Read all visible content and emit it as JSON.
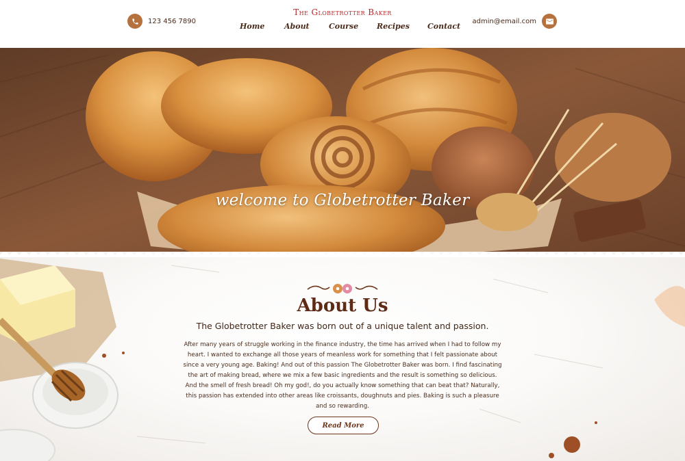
{
  "header": {
    "phone": "123 456 7890",
    "email": "admin@email.com",
    "brand": "The Globetrotter Baker",
    "nav": [
      "Home",
      "About",
      "Course",
      "Recipes",
      "Contact"
    ]
  },
  "icons": {
    "phone": "phone-icon",
    "email": "envelope-icon",
    "ornament": "donut-ornament-icon"
  },
  "hero": {
    "title": "welcome to Globetrotter Baker"
  },
  "about": {
    "title": "About Us",
    "subtitle": "The Globetrotter Baker was born out of a unique talent and passion.",
    "body": "After many years of struggle working in the finance industry, the time has arrived when I had to follow my heart. I wanted to exchange all those years of meanless work for something that I felt passionate about since a very young age. Baking! And out of this passion The Globetrotter Baker was born. I find fascinating the art of making bread, where we mix a few basic ingredients and the result is something so delicious. And the smell of fresh bread! Oh my god!, do you actually know something that can beat that? Naturally, this passion has extended into other areas like croissants, doughnuts and pies. Baking is such a pleasure and so rewarding.",
    "button": "Read More"
  },
  "colors": {
    "accent": "#b5723e",
    "brand": "#b3262a",
    "text_dark": "#5e2b16"
  }
}
